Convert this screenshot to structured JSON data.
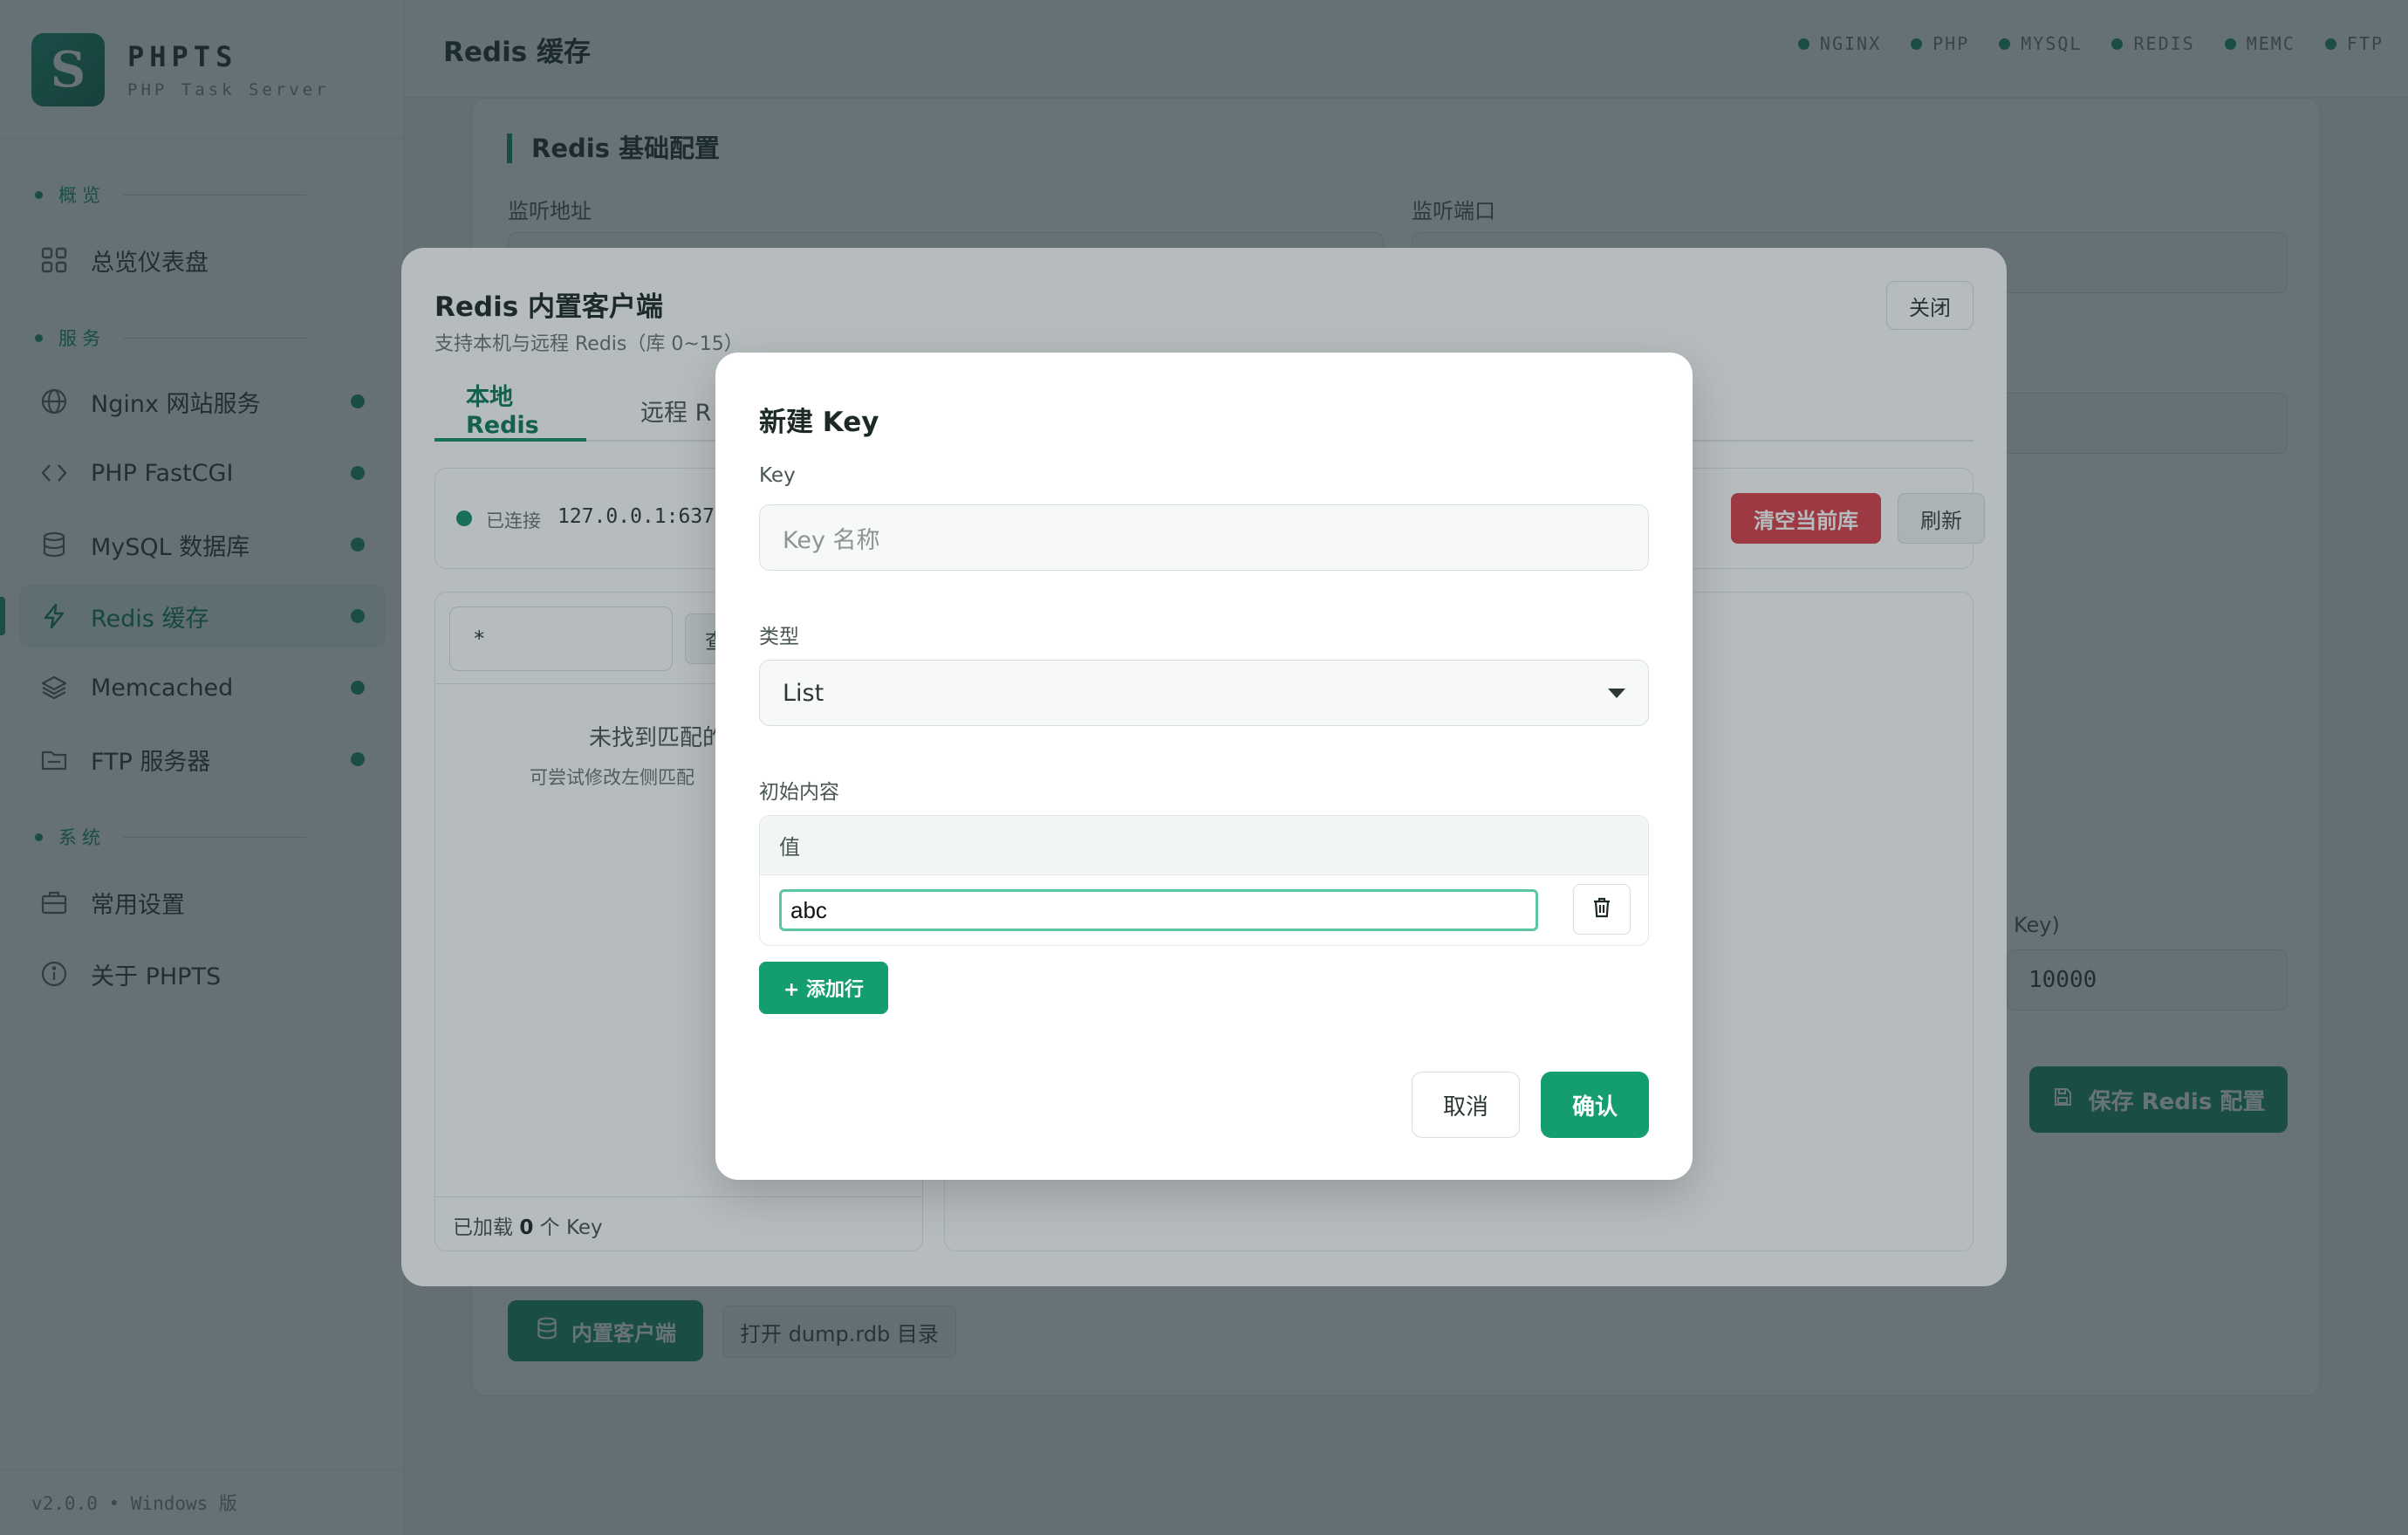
{
  "app": {
    "name": "PHPTS",
    "subtitle": "PHP Task Server",
    "version": "v2.0.0 • Windows 版",
    "brand_color": "#1a8f6c"
  },
  "sidebar": {
    "sections": {
      "overview": "概览",
      "services": "服务",
      "system": "系统"
    },
    "items": [
      {
        "label": "总览仪表盘",
        "icon": "dashboard-icon"
      },
      {
        "label": "Nginx 网站服务",
        "icon": "globe-icon",
        "status": "running"
      },
      {
        "label": "PHP FastCGI",
        "icon": "code-icon",
        "status": "running"
      },
      {
        "label": "MySQL 数据库",
        "icon": "database-icon",
        "status": "running"
      },
      {
        "label": "Redis 缓存",
        "icon": "bolt-icon",
        "status": "running",
        "active": true
      },
      {
        "label": "Memcached",
        "icon": "layers-icon",
        "status": "running"
      },
      {
        "label": "FTP 服务器",
        "icon": "folder-icon",
        "status": "running"
      },
      {
        "label": "常用设置",
        "icon": "briefcase-icon"
      },
      {
        "label": "关于 PHPTS",
        "icon": "info-icon"
      }
    ]
  },
  "header": {
    "title": "Redis 缓存",
    "services": [
      "NGINX",
      "PHP",
      "MYSQL",
      "REDIS",
      "MEMC",
      "FTP"
    ]
  },
  "page": {
    "section_title": "Redis 基础配置",
    "listen_address_label": "监听地址",
    "listen_port_label": "监听端口",
    "partial_label": "Key)",
    "partial_value": "10000",
    "save_button": "保存 Redis 配置",
    "builtin_client_button": "内置客户端",
    "open_dump_button": "打开 dump.rdb 目录"
  },
  "client_dialog": {
    "title": "Redis 内置客户端",
    "subtitle": "支持本机与远程 Redis（库 0~15）",
    "close_button": "关闭",
    "tabs": [
      "本地 Redis",
      "远程 R"
    ],
    "status_text": "已连接",
    "address": "127.0.0.1:637",
    "flush_button": "清空当前库",
    "refresh_button": "刷新",
    "pattern_value": "*",
    "query_button": "查",
    "empty_title": "未找到匹配的",
    "empty_hint": "可尝试修改左侧匹配",
    "footer_prefix": "已加载",
    "footer_count": "0",
    "footer_suffix": "个 Key"
  },
  "new_key_modal": {
    "title": "新建 Key",
    "key_label": "Key",
    "key_placeholder": "Key 名称",
    "type_label": "类型",
    "type_value": "List",
    "content_label": "初始内容",
    "column_header": "值",
    "rows": [
      {
        "value": "abc"
      }
    ],
    "add_row_button": "+ 添加行",
    "cancel_button": "取消",
    "confirm_button": "确认"
  }
}
